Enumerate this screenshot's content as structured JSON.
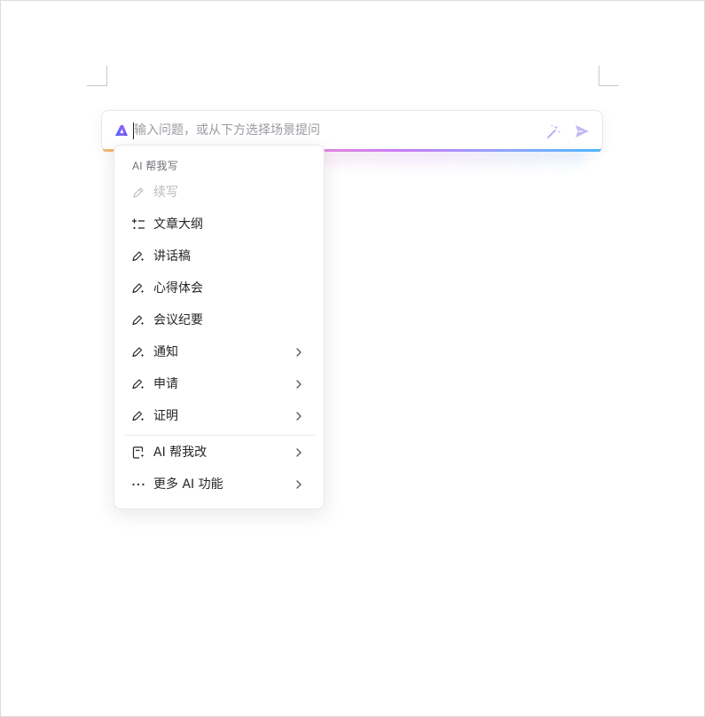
{
  "prompt": {
    "placeholder": "输入问题，或从下方选择场景提问",
    "value": ""
  },
  "menu": {
    "section_title": "AI 帮我写",
    "items": [
      {
        "label": "续写",
        "icon": "pen-icon",
        "disabled": true,
        "has_submenu": false
      },
      {
        "label": "文章大纲",
        "icon": "outline-list-icon",
        "disabled": false,
        "has_submenu": false
      },
      {
        "label": "讲话稿",
        "icon": "pen-sparkle-icon",
        "disabled": false,
        "has_submenu": false
      },
      {
        "label": "心得体会",
        "icon": "pen-sparkle-icon",
        "disabled": false,
        "has_submenu": false
      },
      {
        "label": "会议纪要",
        "icon": "pen-sparkle-icon",
        "disabled": false,
        "has_submenu": false
      },
      {
        "label": "通知",
        "icon": "pen-sparkle-icon",
        "disabled": false,
        "has_submenu": true
      },
      {
        "label": "申请",
        "icon": "pen-sparkle-icon",
        "disabled": false,
        "has_submenu": true
      },
      {
        "label": "证明",
        "icon": "pen-sparkle-icon",
        "disabled": false,
        "has_submenu": true
      }
    ],
    "extra_items": [
      {
        "label": "AI 帮我改",
        "icon": "doc-edit-sparkle-icon",
        "has_submenu": true
      },
      {
        "label": "更多 AI 功能",
        "icon": "more-dots-icon",
        "has_submenu": true
      }
    ]
  },
  "colors": {
    "accent_gradient": [
      "#f7b46b",
      "#f08ad2",
      "#c97cf5",
      "#8aa7ff",
      "#4fb6ff"
    ],
    "logo_blue": "#3d6bff",
    "logo_purple": "#b45cf0",
    "send_inactive": "#c5b8f5",
    "text": "#26262b",
    "muted": "#9a9aa2",
    "disabled": "#b9b9be"
  }
}
